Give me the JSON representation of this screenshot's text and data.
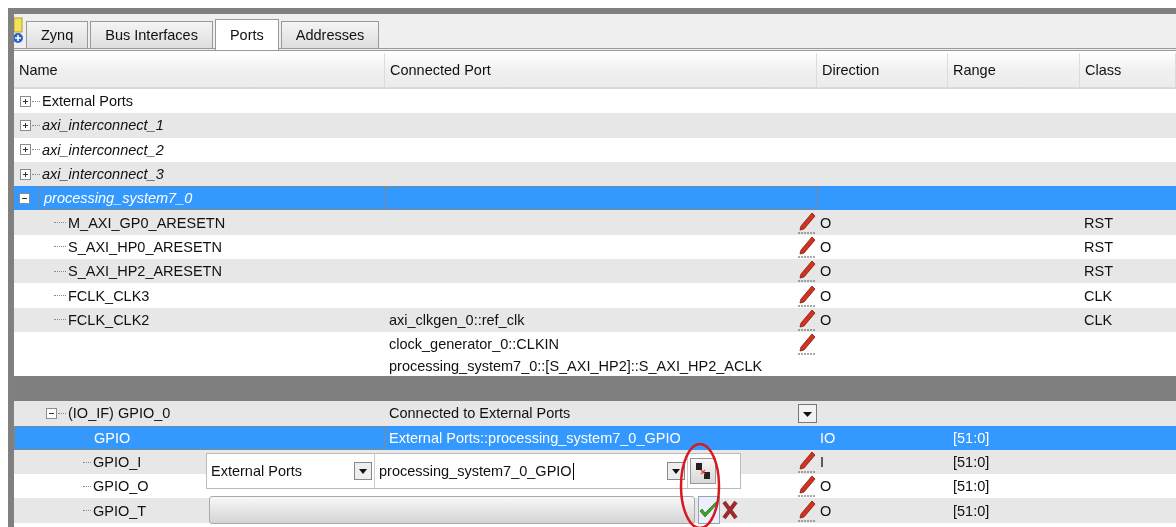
{
  "tabs": [
    {
      "label": "Zynq",
      "selected": false
    },
    {
      "label": "Bus Interfaces",
      "selected": false
    },
    {
      "label": "Ports",
      "selected": true
    },
    {
      "label": "Addresses",
      "selected": false
    }
  ],
  "columns": [
    "Name",
    "Connected Port",
    "Direction",
    "Range",
    "Class"
  ],
  "upper_tree": [
    {
      "label": "External Ports",
      "kind": "external",
      "expanded": false,
      "selected": false
    },
    {
      "label": "axi_interconnect_1",
      "kind": "instance",
      "expanded": false,
      "selected": false
    },
    {
      "label": "axi_interconnect_2",
      "kind": "instance",
      "expanded": false,
      "selected": false
    },
    {
      "label": "axi_interconnect_3",
      "kind": "instance",
      "expanded": false,
      "selected": false
    },
    {
      "label": "processing_system7_0",
      "kind": "instance",
      "expanded": true,
      "selected": true,
      "children": [
        {
          "name": "M_AXI_GP0_ARESETN",
          "direction": "O",
          "class": "RST",
          "selected": false,
          "lines": [
            {
              "editable": true
            }
          ]
        },
        {
          "name": "S_AXI_HP0_ARESETN",
          "direction": "O",
          "class": "RST",
          "selected": false,
          "lines": [
            {
              "editable": true
            }
          ]
        },
        {
          "name": "S_AXI_HP2_ARESETN",
          "direction": "O",
          "class": "RST",
          "selected": false,
          "lines": [
            {
              "editable": true
            }
          ]
        },
        {
          "name": "FCLK_CLK3",
          "direction": "O",
          "class": "CLK",
          "selected": false,
          "lines": [
            {
              "editable": true
            }
          ]
        },
        {
          "name": "FCLK_CLK2",
          "direction": "O",
          "class": "CLK",
          "selected": false,
          "lines": [
            {
              "connected": "axi_clkgen_0::ref_clk",
              "editable": true
            },
            {
              "connected": "clock_generator_0::CLKIN",
              "editable": true
            },
            {
              "connected": "processing_system7_0::[S_AXI_HP2]::S_AXI_HP2_ACLK"
            }
          ]
        }
      ]
    }
  ],
  "lower_tree": [
    {
      "label": "(IO_IF) GPIO_0",
      "expanded": true,
      "selected": false,
      "connected": "Connected to External Ports",
      "has_menu": true,
      "children": [
        {
          "name": "GPIO",
          "direction": "IO",
          "range": "[51:0]",
          "selected": true,
          "lines": [
            {
              "connected": "External Ports::processing_system7_0_GPIO"
            }
          ]
        },
        {
          "name": "GPIO_I",
          "direction": "I",
          "range": "[51:0]",
          "selected": false,
          "lines": [
            {
              "editable": true
            }
          ]
        },
        {
          "name": "GPIO_O",
          "direction": "O",
          "range": "[51:0]",
          "selected": false,
          "lines": [
            {
              "editable": true
            }
          ]
        },
        {
          "name": "GPIO_T",
          "direction": "O",
          "range": "[51:0]",
          "selected": false,
          "lines": [
            {
              "editable": true
            }
          ]
        }
      ]
    }
  ],
  "editor": {
    "scope": "External Ports",
    "port_value": "processing_system7_0_GPIO"
  }
}
